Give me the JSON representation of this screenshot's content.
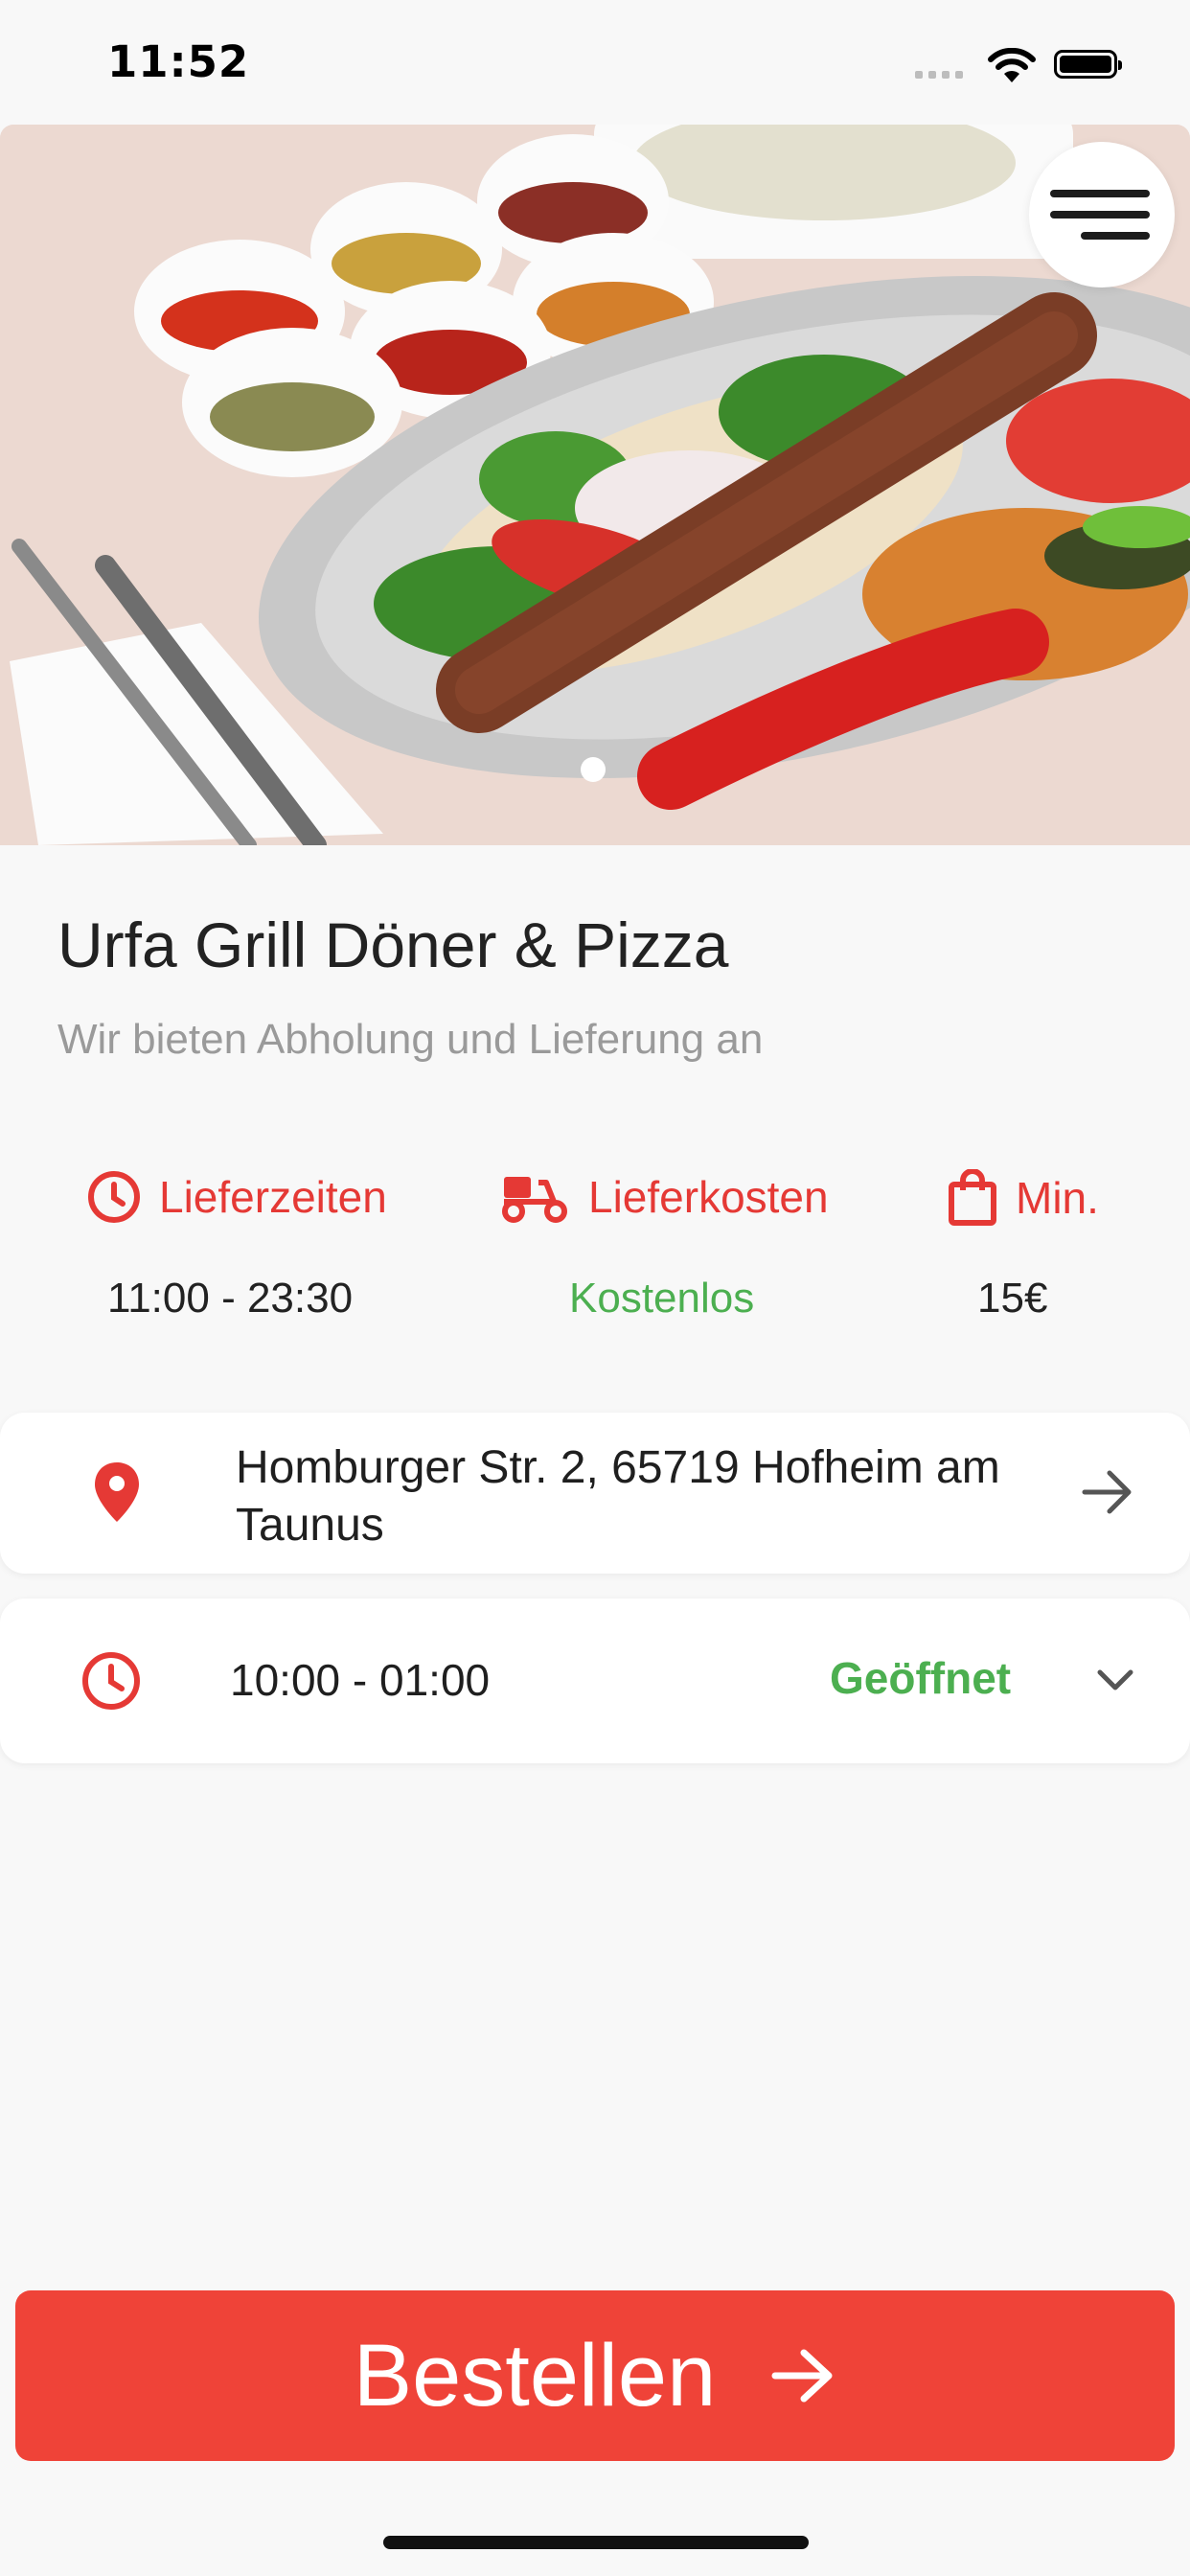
{
  "status_bar": {
    "time": "11:52"
  },
  "hero": {
    "image_description_icon": "food-photo-kebab-platter"
  },
  "restaurant": {
    "name": "Urfa Grill Döner & Pizza",
    "tagline": "Wir bieten Abholung und Lieferung an"
  },
  "info": {
    "delivery_times_label": "Lieferzeiten",
    "delivery_times_value": "11:00 - 23:30",
    "delivery_cost_label": "Lieferkosten",
    "delivery_cost_value": "Kostenlos",
    "minimum_label": "Min.",
    "minimum_value": "15€"
  },
  "address": {
    "text": "Homburger Str. 2, 65719 Hofheim am Taunus"
  },
  "hours": {
    "text": "10:00 - 01:00",
    "status": "Geöffnet"
  },
  "order_button": {
    "label": "Bestellen"
  },
  "colors": {
    "accent": "#ef4338",
    "green": "#4caf50",
    "label_red": "#e53935"
  }
}
